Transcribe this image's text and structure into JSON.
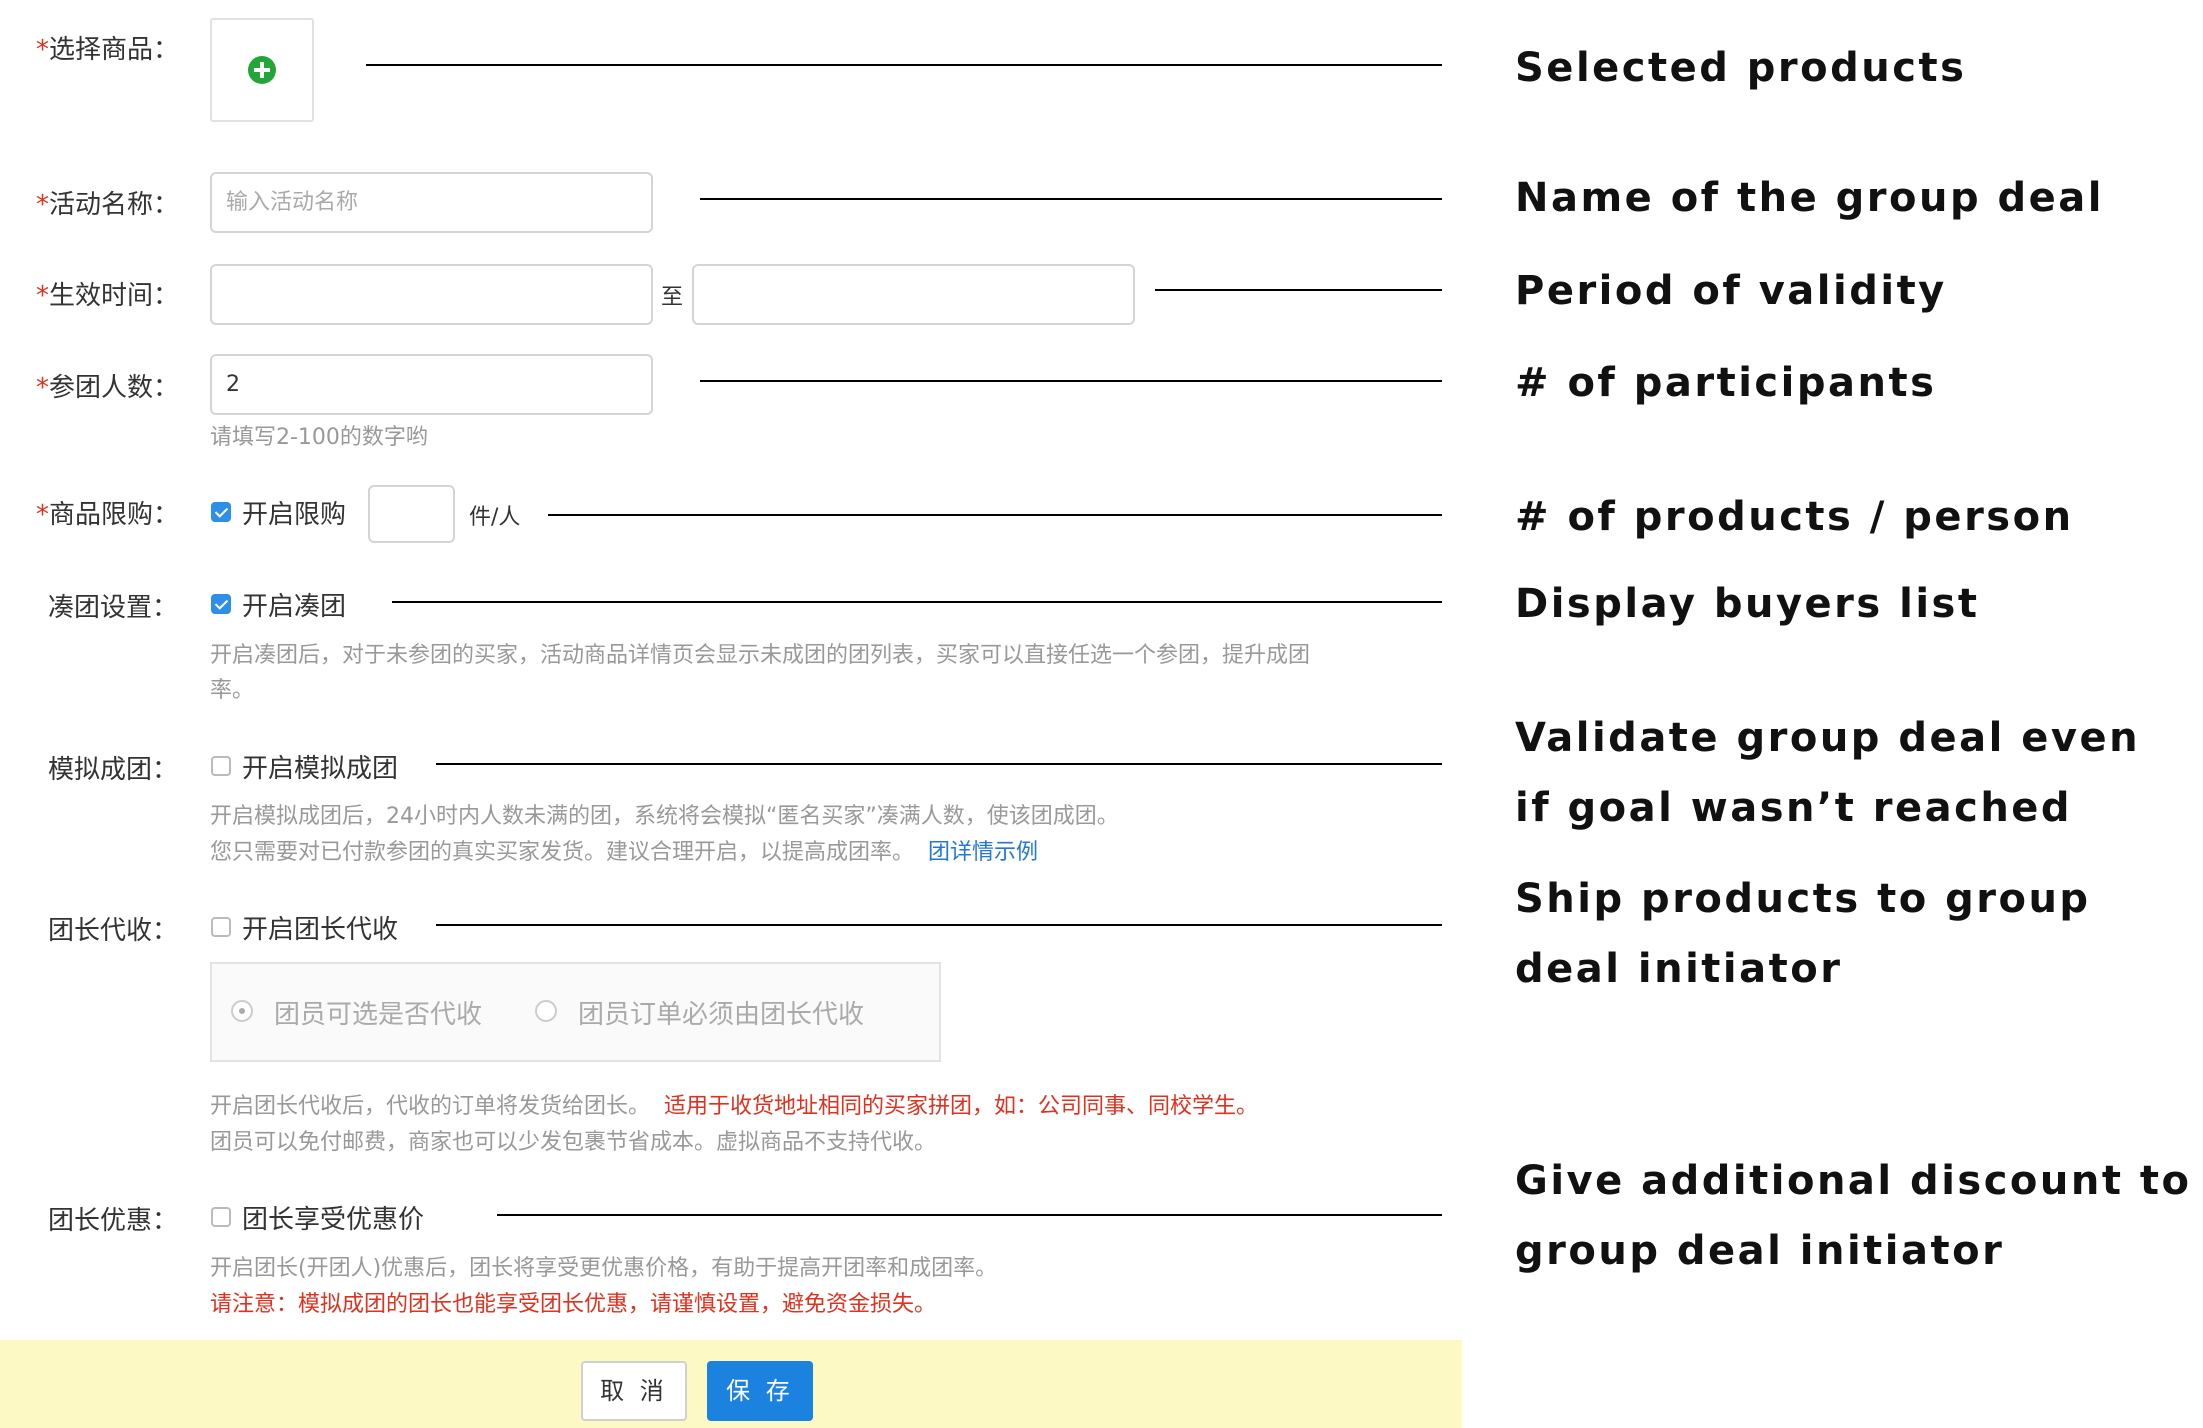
{
  "form": {
    "product": {
      "label": "选择商品："
    },
    "name": {
      "label": "活动名称：",
      "placeholder": "输入活动名称",
      "value": ""
    },
    "period": {
      "label": "生效时间：",
      "separator": "至"
    },
    "participants": {
      "label": "参团人数：",
      "value": "2",
      "hint": "请填写2-100的数字哟"
    },
    "limit": {
      "label": "商品限购：",
      "checkbox_label": "开启限购",
      "checked": true,
      "value": "",
      "unit": "件/人"
    },
    "gather": {
      "label": "凑团设置：",
      "checkbox_label": "开启凑团",
      "checked": true,
      "hint_line1": "开启凑团后，对于未参团的买家，活动商品详情页会显示未成团的团列表，买家可以直接任选一个参团，提升成团",
      "hint_line2": "率。"
    },
    "simulate": {
      "label": "模拟成团：",
      "checkbox_label": "开启模拟成团",
      "checked": false,
      "hint_line1": "开启模拟成团后，24小时内人数未满的团，系统将会模拟“匿名买家”凑满人数，使该团成团。",
      "hint_line2": "您只需要对已付款参团的真实买家发货。建议合理开启，以提高成团率。",
      "link": "团详情示例"
    },
    "collect": {
      "label": "团长代收：",
      "checkbox_label": "开启团长代收",
      "checked": false,
      "option1": "团员可选是否代收",
      "option2": "团员订单必须由团长代收",
      "hint_line1": "开启团长代收后，代收的订单将发货给团长。",
      "hint_line1_red": "适用于收货地址相同的买家拼团，如：公司同事、同校学生。",
      "hint_line2": "团员可以免付邮费，商家也可以少发包裹节省成本。虚拟商品不支持代收。"
    },
    "discount": {
      "label": "团长优惠：",
      "checkbox_label": "团长享受优惠价",
      "checked": false,
      "hint_line1": "开启团长(开团人)优惠后，团长将享受更优惠价格，有助于提高开团率和成团率。",
      "hint_line2_red": "请注意：模拟成团的团长也能享受团长优惠，请谨慎设置，避免资金损失。"
    }
  },
  "buttons": {
    "cancel": "取 消",
    "save": "保 存"
  },
  "annotations": {
    "selected_products": "Selected products",
    "name": "Name of the group deal",
    "period": "Period of validity",
    "participants": "# of participants",
    "products_per_person": "# of products / person",
    "buyers_list": "Display buyers list",
    "validate_line1": "Validate group deal even",
    "validate_line2": "if goal wasn’t reached",
    "ship_line1": "Ship products to group",
    "ship_line2": "deal initiator",
    "discount_line1": "Give additional discount to",
    "discount_line2": "group deal initiator"
  },
  "colors": {
    "required": "#e0301e",
    "primary": "#2e8ee8",
    "footer_bg": "#fdf9c4",
    "add_icon": "#22a638"
  },
  "icons": [
    "add-circle-icon",
    "checkbox",
    "radio"
  ]
}
